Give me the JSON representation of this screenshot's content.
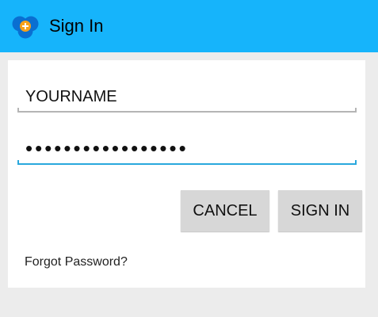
{
  "app": {
    "title": "Sign In",
    "icon": "tri-circle-plus-logo"
  },
  "form": {
    "username_value": "YOURNAME",
    "password_value": "•••••••••••••••••",
    "cancel_label": "CANCEL",
    "signin_label": "SIGN IN",
    "forgot_link": "Forgot Password?"
  },
  "colors": {
    "titlebar": "#16b4fb",
    "background": "#ececec",
    "card": "#ffffff",
    "active_underline": "#29a8dd",
    "button": "#d7d7d7",
    "logo_blue": "#0a6fd1",
    "logo_orange": "#f7a11a"
  }
}
